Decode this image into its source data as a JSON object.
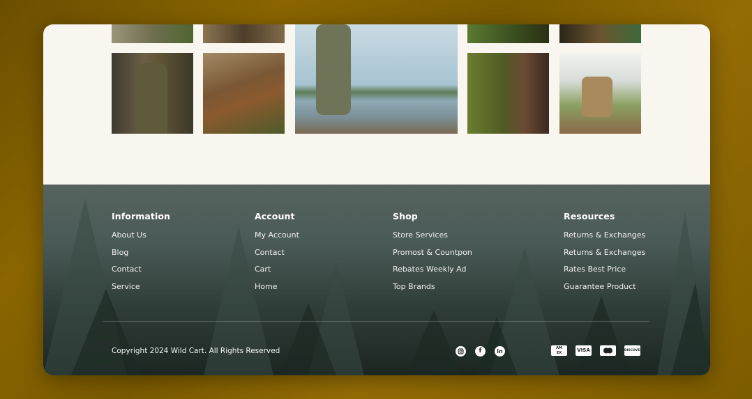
{
  "gallery": {
    "photos": [
      {
        "name": "trail-photo",
        "color": "#8f8a6e"
      },
      {
        "name": "boots-photo-top",
        "color": "#6b5a3e"
      },
      {
        "name": "fisherman-photo",
        "color": "#a9bfc9"
      },
      {
        "name": "moss-photo",
        "color": "#4f6a2c"
      },
      {
        "name": "gear-photo-top",
        "color": "#3f3522"
      },
      {
        "name": "hunter-photo",
        "color": "#5a4c3b"
      },
      {
        "name": "hiking-boots-photo",
        "color": "#7a5a34"
      },
      {
        "name": "binoculars-photo",
        "color": "#5d6b33"
      },
      {
        "name": "backpack-photo",
        "color": "#b7a074"
      }
    ]
  },
  "footer": {
    "columns": [
      {
        "title": "Information",
        "links": [
          "About Us",
          "Blog",
          "Contact",
          "Service"
        ]
      },
      {
        "title": "Account",
        "links": [
          "My Account",
          "Contact",
          "Cart",
          "Home"
        ]
      },
      {
        "title": "Shop",
        "links": [
          "Store Services",
          "Promost & Countpon",
          "Rebates Weekly Ad",
          "Top Brands"
        ]
      },
      {
        "title": "Resources",
        "links": [
          "Returns & Exchanges",
          "Returns & Exchanges",
          "Rates Best Price",
          "Guarantee Product"
        ]
      }
    ],
    "copyright": "Copyright 2024 Wild Cart. All Rights Reserved",
    "social": [
      "instagram-icon",
      "facebook-icon",
      "linkedin-icon"
    ],
    "payments": [
      "AMEX",
      "VISA",
      "MASTERCARD",
      "DISCOVER"
    ]
  }
}
